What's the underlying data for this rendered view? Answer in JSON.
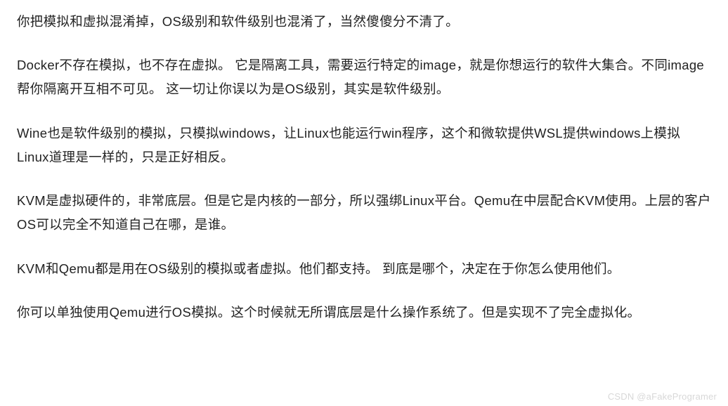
{
  "paragraphs": [
    "你把模拟和虚拟混淆掉，OS级别和软件级别也混淆了，当然傻傻分不清了。",
    "Docker不存在模拟，也不存在虚拟。 它是隔离工具，需要运行特定的image，就是你想运行的软件大集合。不同image帮你隔离开互相不可见。 这一切让你误以为是OS级别，其实是软件级别。",
    "Wine也是软件级别的模拟，只模拟windows，让Linux也能运行win程序，这个和微软提供WSL提供windows上模拟Linux道理是一样的，只是正好相反。",
    "KVM是虚拟硬件的，非常底层。但是它是内核的一部分，所以强绑Linux平台。Qemu在中层配合KVM使用。上层的客户OS可以完全不知道自己在哪，是谁。",
    "KVM和Qemu都是用在OS级别的模拟或者虚拟。他们都支持。 到底是哪个，决定在于你怎么使用他们。",
    "你可以单独使用Qemu进行OS模拟。这个时候就无所谓底层是什么操作系统了。但是实现不了完全虚拟化。"
  ],
  "watermark": "CSDN @aFakeProgramer"
}
